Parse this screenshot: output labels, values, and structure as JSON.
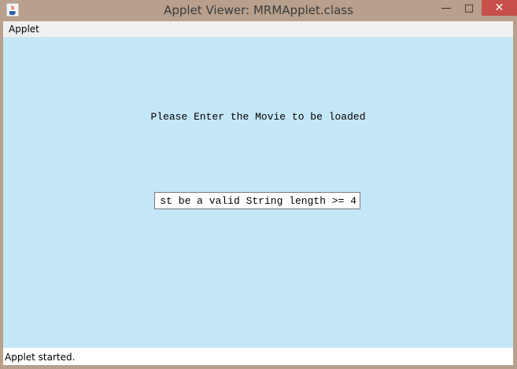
{
  "window": {
    "title": "Applet Viewer: MRMApplet.class",
    "controls": {
      "minimize": "—",
      "maximize": "□",
      "close": "✕"
    }
  },
  "menubar": {
    "items": [
      "Applet"
    ]
  },
  "applet": {
    "prompt": "Please Enter the Movie to be loaded",
    "input_value": "st be a valid String length >= 4"
  },
  "status": {
    "text": "Applet started."
  },
  "colors": {
    "titlebar": "#b8a08c",
    "content_bg": "#c4e7f8",
    "close_button": "#c7504a"
  },
  "icons": {
    "app": "java-coffee-icon"
  }
}
